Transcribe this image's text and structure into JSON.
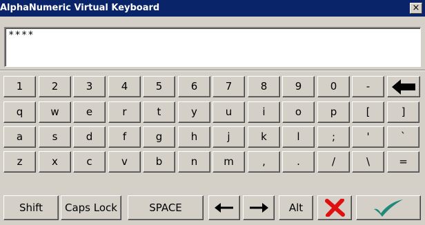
{
  "window": {
    "title": "AlphaNumeric Virtual Keyboard",
    "close_label": "×"
  },
  "display": {
    "value": "****"
  },
  "keyboard": {
    "rows": [
      [
        "1",
        "2",
        "3",
        "4",
        "5",
        "6",
        "7",
        "8",
        "9",
        "0",
        "-"
      ],
      [
        "q",
        "w",
        "e",
        "r",
        "t",
        "y",
        "u",
        "i",
        "o",
        "p",
        "[",
        "]"
      ],
      [
        "a",
        "s",
        "d",
        "f",
        "g",
        "h",
        "j",
        "k",
        "l",
        ";",
        "'",
        "`"
      ],
      [
        "z",
        "x",
        "c",
        "v",
        "b",
        "n",
        "m",
        ",",
        ".",
        "/",
        "\\",
        "="
      ]
    ],
    "bottom": {
      "shift": "Shift",
      "caps_lock": "Caps Lock",
      "space": "SPACE",
      "alt": "Alt"
    }
  },
  "icons": {
    "backspace": "backspace-arrow-icon",
    "left_arrow": "left-arrow-icon",
    "right_arrow": "right-arrow-icon",
    "cancel": "red-x-icon",
    "ok": "green-check-icon"
  },
  "colors": {
    "titlebar": "#0a246a",
    "face": "#d4d0c8",
    "cancel": "#e01010",
    "ok": "#1f8a7a"
  }
}
